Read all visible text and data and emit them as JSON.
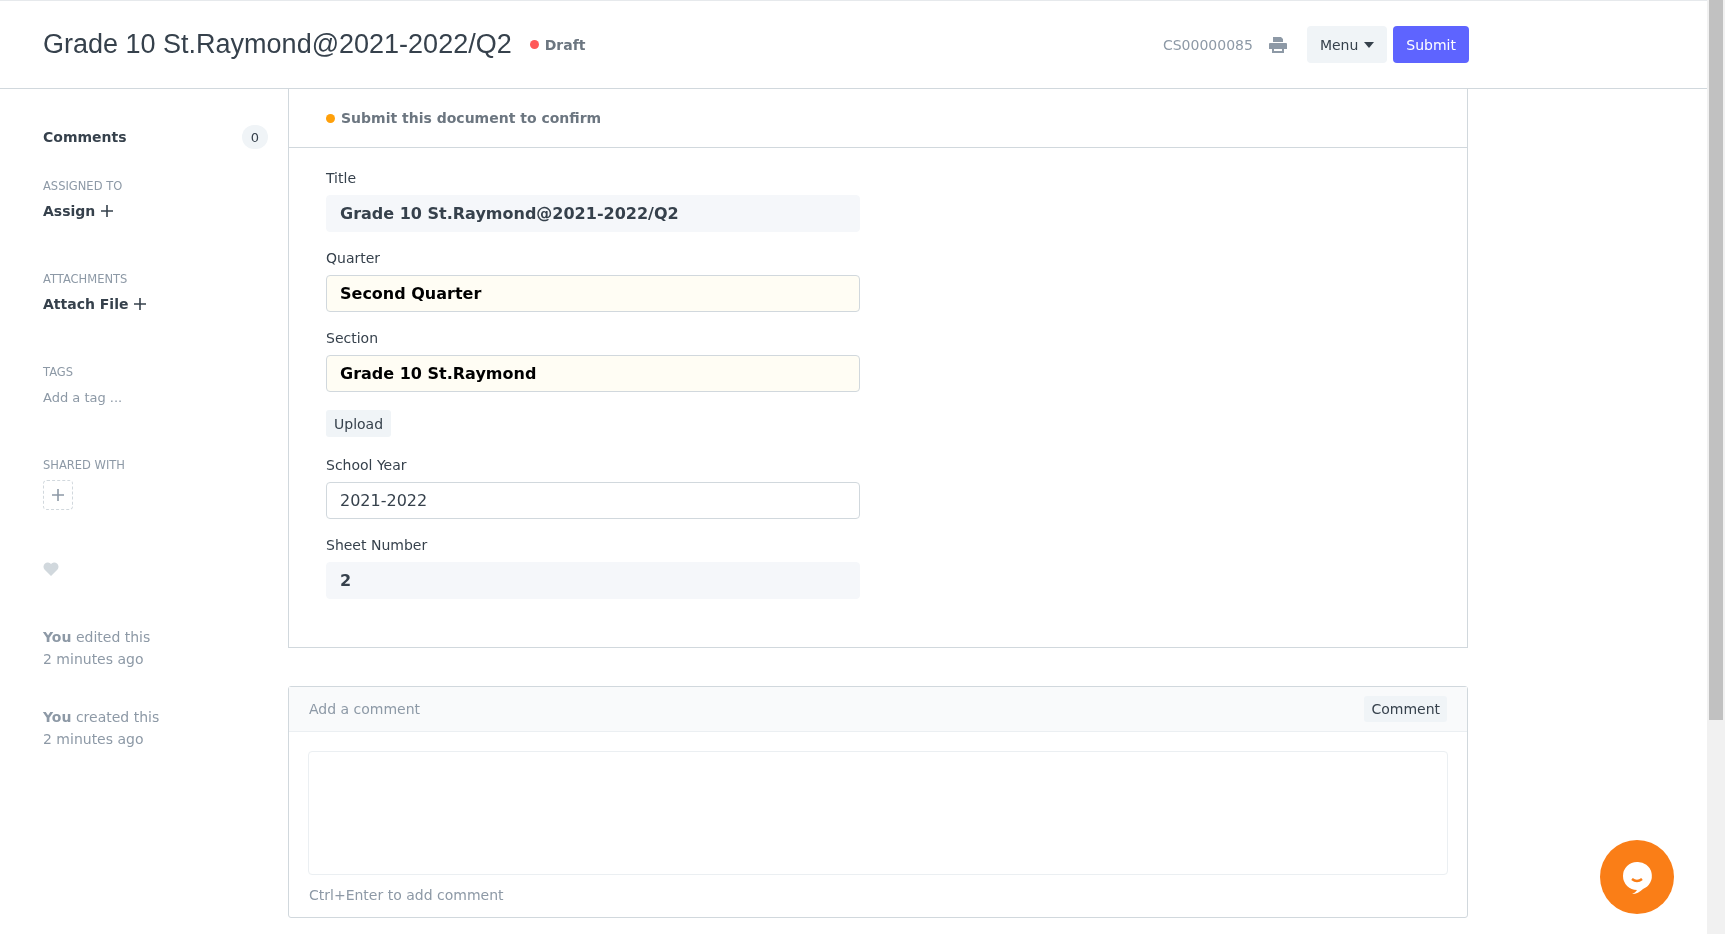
{
  "header": {
    "title": "Grade 10 St.Raymond@2021-2022/Q2",
    "status": {
      "label": "Draft",
      "color": "#ff5858"
    },
    "doc_id": "CS00000085",
    "menu_button": "Menu",
    "submit_button": "Submit"
  },
  "sidebar": {
    "comments": {
      "label": "Comments",
      "count": "0"
    },
    "assigned_to": {
      "heading": "ASSIGNED TO",
      "action": "Assign"
    },
    "attachments": {
      "heading": "ATTACHMENTS",
      "action": "Attach File"
    },
    "tags": {
      "heading": "TAGS",
      "placeholder": "Add a tag ..."
    },
    "shared_with": {
      "heading": "SHARED WITH"
    },
    "liked": false,
    "activity": [
      {
        "text": "**You** edited this",
        "time": "2 minutes ago"
      },
      {
        "text": "**You** created this",
        "time": "2 minutes ago"
      }
    ]
  },
  "alert": {
    "text": "Submit this document to confirm",
    "color": "#ffa00a"
  },
  "form": {
    "fields": [
      {
        "kind": "readonly",
        "label": "Title",
        "value": "Grade 10 St.Raymond@2021-2022/Q2"
      },
      {
        "kind": "link",
        "label": "Quarter",
        "value": "Second Quarter"
      },
      {
        "kind": "link",
        "label": "Section",
        "value": "Grade 10 St.Raymond"
      },
      {
        "kind": "button",
        "label": "Upload"
      },
      {
        "kind": "data",
        "label": "School Year",
        "value": "2021-2022"
      },
      {
        "kind": "readonly",
        "label": "Sheet Number",
        "value": "2"
      }
    ]
  },
  "comment_box": {
    "placeholder": "Add a comment",
    "button": "Comment",
    "hint": "Ctrl+Enter to add comment"
  }
}
